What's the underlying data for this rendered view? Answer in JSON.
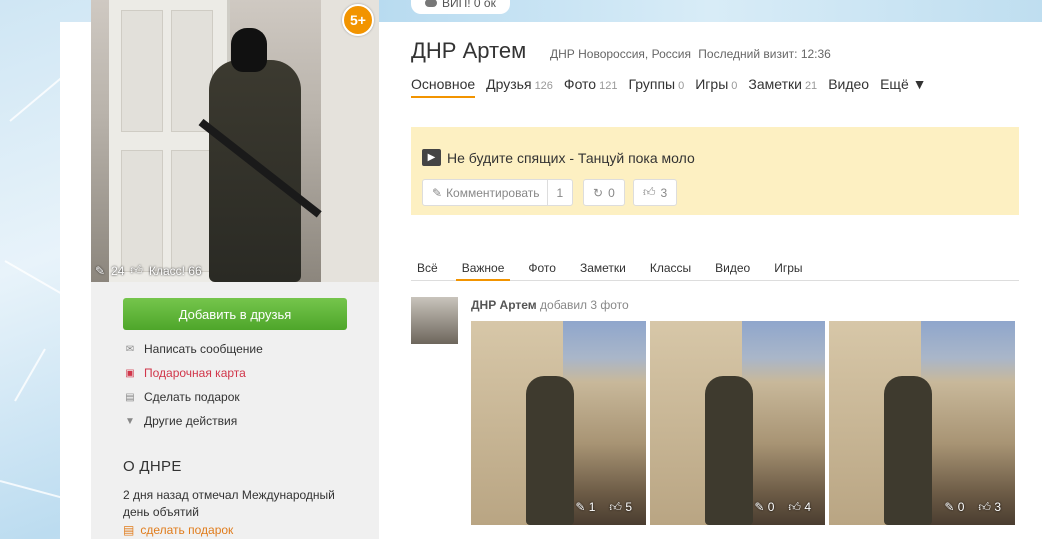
{
  "topbar": {
    "vip_label": "ВИП! 0 ок"
  },
  "profile": {
    "badge": "5+",
    "photo_comments": "24",
    "photo_likes": "Класс! 66",
    "name": "ДНР Артем",
    "location": "ДНР Новороссия, Россия",
    "last_visit": "Последний визит: 12:36"
  },
  "tabs": [
    {
      "label": "Основное",
      "count": ""
    },
    {
      "label": "Друзья",
      "count": "126"
    },
    {
      "label": "Фото",
      "count": "121"
    },
    {
      "label": "Группы",
      "count": "0"
    },
    {
      "label": "Игры",
      "count": "0"
    },
    {
      "label": "Заметки",
      "count": "21"
    },
    {
      "label": "Видео",
      "count": ""
    },
    {
      "label": "Ещё ▼",
      "count": ""
    }
  ],
  "left": {
    "add_friend": "Добавить в друзья",
    "actions": [
      {
        "label": "Написать сообщение",
        "icon": "envelope-icon"
      },
      {
        "label": "Подарочная карта",
        "icon": "gift-card-icon"
      },
      {
        "label": "Сделать подарок",
        "icon": "gift-icon"
      },
      {
        "label": "Другие действия",
        "icon": "triangle-down-icon"
      }
    ],
    "about_title": "О ДНРЕ",
    "about_text": "2 дня назад отмечал Международный день объятий",
    "gift_link": "сделать подарок"
  },
  "status": {
    "text": "Не будите спящих - Танцуй пока моло",
    "comment_label": "Комментировать",
    "comment_count": "1",
    "share_count": "0",
    "like_count": "3"
  },
  "feed_tabs": [
    "Всё",
    "Важное",
    "Фото",
    "Заметки",
    "Классы",
    "Видео",
    "Игры"
  ],
  "feed": {
    "author": "ДНР Артем",
    "action": "добавил 3 фото",
    "photos": [
      {
        "comments": "1",
        "likes": "5"
      },
      {
        "comments": "0",
        "likes": "4"
      },
      {
        "comments": "0",
        "likes": "3"
      }
    ]
  },
  "colors": {
    "accent": "#f29400",
    "green": "#5cb531",
    "status_bg": "#fdf0c2",
    "red_link": "#d1364a"
  }
}
